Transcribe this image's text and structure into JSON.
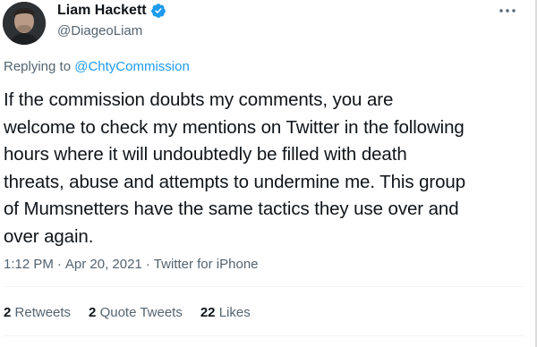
{
  "author": {
    "display_name": "Liam Hackett",
    "handle": "@DiageoLiam",
    "verified": true
  },
  "reply": {
    "prefix": "Replying to ",
    "target": "@ChtyCommission"
  },
  "tweet": {
    "text": "If the commission doubts my comments, you are\nwelcome to check my mentions on Twitter in the following\nhours where it will undoubtedly be filled with death\nthreats, abuse and attempts to undermine me. This group\nof Mumsnetters have the same tactics they use over and\nover again."
  },
  "meta": {
    "time": "1:12 PM",
    "separator": "·",
    "date": "Apr 20, 2021",
    "source": "Twitter for iPhone"
  },
  "stats": [
    {
      "count": "2",
      "label": "Retweets"
    },
    {
      "count": "2",
      "label": "Quote Tweets"
    },
    {
      "count": "22",
      "label": "Likes"
    }
  ],
  "colors": {
    "accent": "#1d9bf0",
    "text": "#0f1419",
    "muted": "#536471"
  }
}
